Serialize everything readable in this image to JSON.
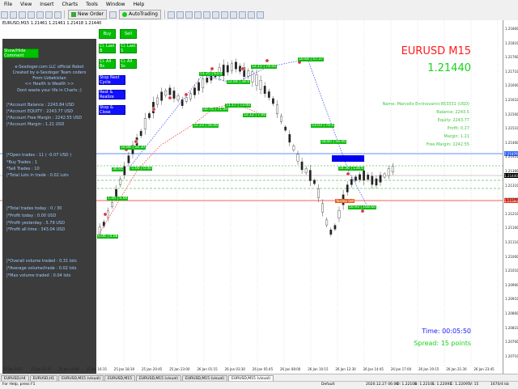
{
  "menu": [
    "File",
    "View",
    "Insert",
    "Charts",
    "Tools",
    "Window",
    "Help"
  ],
  "toolbar": {
    "new_order": "New Order",
    "auto_trading": "AutoTrading"
  },
  "chart": {
    "symbol_info": "EURUSD,M15 1.21461 1.21461 1.21418 1.21440",
    "pair_title": "EURUSD M15",
    "pair_price": "1.21440",
    "info_lines": [
      "Name: Marcello Enrinovanni-853331 (USD)",
      "Balance: 2243.5",
      "Equity: 2243.77",
      "Profit: 0.27",
      "Margin: 1.21",
      "Free Margin: 2242.55"
    ],
    "timer": "Time: 00:05:50",
    "spread": "Spread: 15 points",
    "label_sell": "Yasdoo Sell"
  },
  "panel": {
    "toggle_button": "Show/Hide Comment",
    "intro": [
      "e-Sexdoger.com LLC official Robot",
      "Created by e-Sexdoger Team coders",
      "From Uzbekistan",
      "<< Health is Wealth >>",
      "Dont waste your life in Charts ;)"
    ],
    "account": [
      "|*Account Balance   : 2243.84 USD",
      "|*Account EQUITY    : 2243.77 USD",
      "|*Account Free Margin  : 2242.55 USD",
      "|*Account Margin    : 1.21 USD"
    ],
    "open_trades": [
      "|*Open trades   : 11 ( -0.07 USD )",
      "   *Buy Trades   : 1",
      "   *Sell Trades  : 10",
      "|*Total Lots in trade  : 0.02 Lots"
    ],
    "today": [
      "|*Total trades today  : 0 / 30",
      "|*Profit today     : 0.00 USD",
      "|*Profit yesterday   : 5.79 USD",
      "|*Profit all time    : 343.04 USD"
    ],
    "volume": [
      "|*Overall volume traded  : 0.31 lots",
      "|*Average volume/trade  : 0.02 lots",
      "|*Max volume traded   : 0.04 lots"
    ]
  },
  "buttons": {
    "buy": "Buy",
    "sell": "Sell",
    "cl_last_b": "Cl. Last B",
    "cl_last_s": "Cl. Last S",
    "cl_all_bs": "Cl. All Bs",
    "cl_all_ss": "Cl. All Ss",
    "stop_next_cycle": "Stop Next Cycle",
    "rest_realize": "Rest & Realize",
    "stop_close": "Stop & Close"
  },
  "price_axis": [
    "1.21860",
    "1.21810",
    "1.21760",
    "1.21710",
    "1.21660",
    "1.21610",
    "1.21560",
    "1.21510",
    "1.21460",
    "1.21410",
    "1.21360",
    "1.21310",
    "1.21260",
    "1.21210",
    "1.21160",
    "1.21110",
    "1.21060",
    "1.21010",
    "1.20960",
    "1.20910",
    "1.20860",
    "1.20810",
    "1.20760",
    "1.20710"
  ],
  "price_tags": {
    "bid": "1.21440",
    "level_red": "1.21300",
    "level_blue": "1.21476"
  },
  "time_axis": [
    "25 Jan 2021",
    "25 Jan 11:45",
    "25 Jan 14:00",
    "25 Jan 16:15",
    "25 Jan 18:30",
    "25 Jan 20:45",
    "25 Jan 23:00",
    "26 Jan 01:15",
    "26 Jan 03:30",
    "26 Jan 05:45",
    "26 Jan 08:00",
    "26 Jan 10:15",
    "26 Jan 12:30",
    "26 Jan 14:45",
    "26 Jan 17:00",
    "26 Jan 19:15",
    "26 Jan 21:30",
    "26 Jan 23:45"
  ],
  "tabs": [
    "EURUSD,H4",
    "EURUSD,H1",
    "EURUSD,M15 (visual)",
    "EURUSD,M15",
    "EURUSD,M15 (visual)",
    "EURUSD,M15 (visual)",
    "EURUSD,M15 (visual)"
  ],
  "status": {
    "help": "For Help, press F1",
    "profile": "Default",
    "datetime": "2020.12.27 06:00",
    "open": "O: 1.22101",
    "high": "H: 1.22101",
    "low": "L: 1.22093",
    "close": "C: 1.22095",
    "volume": "V: 15",
    "traffic": "1670/4 kb"
  },
  "colors": {
    "panel_bg": "#3c3c3c",
    "panel_text": "#9ecbff",
    "button_green": "#00c000",
    "button_blue": "#1010ff",
    "title_red": "#ff1a1a",
    "price_green": "#19d219"
  }
}
